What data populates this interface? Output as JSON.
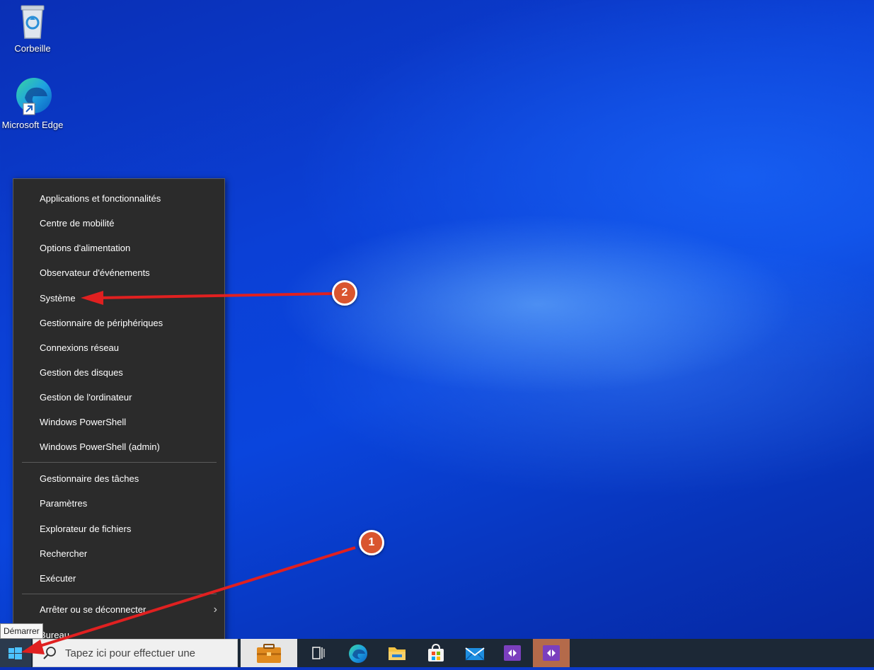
{
  "desktop": {
    "icons": [
      {
        "label": "Corbeille"
      },
      {
        "label": "Microsoft Edge"
      }
    ]
  },
  "context_menu": {
    "group1": [
      "Applications et fonctionnalités",
      "Centre de mobilité",
      "Options d'alimentation",
      "Observateur d'événements",
      "Système",
      "Gestionnaire de périphériques",
      "Connexions réseau",
      "Gestion des disques",
      "Gestion de l'ordinateur",
      "Windows PowerShell",
      "Windows PowerShell (admin)"
    ],
    "group2": [
      "Gestionnaire des tâches",
      "Paramètres",
      "Explorateur de fichiers",
      "Rechercher",
      "Exécuter"
    ],
    "group3": [
      "Arrêter ou se déconnecter",
      "Bureau"
    ],
    "submenu_glyph": "›"
  },
  "taskbar": {
    "search_placeholder": "Tapez ici pour effectuer une",
    "start_tooltip": "Démarrer"
  },
  "annotations": {
    "badge1": "1",
    "badge2": "2",
    "color": "#e02020"
  },
  "colors": {
    "menu_bg": "#2b2b2b",
    "taskbar_bg": "#1c2836",
    "badge_fill": "#d9552f"
  }
}
